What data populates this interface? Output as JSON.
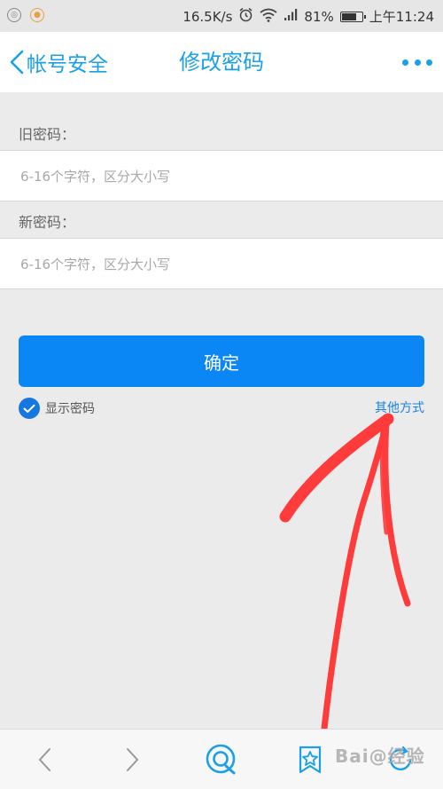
{
  "status_bar": {
    "speed": "16.5K/s",
    "battery": "81%",
    "battery_level": 0.81,
    "time": "上午11:24",
    "icons": [
      "notification-icon",
      "app-icon",
      "alarm-icon",
      "wifi-icon",
      "signal-icon",
      "battery-icon"
    ]
  },
  "header": {
    "back_label": "帐号安全",
    "title": "修改密码",
    "more_icon": "more-dots-icon"
  },
  "form": {
    "old_password": {
      "label": "旧密码：",
      "placeholder": "6-16个字符，区分大小写",
      "value": ""
    },
    "new_password": {
      "label": "新密码：",
      "placeholder": "6-16个字符，区分大小写",
      "value": ""
    },
    "confirm_label": "确定",
    "show_password": {
      "label": "显示密码",
      "checked": true
    },
    "other_methods_label": "其他方式"
  },
  "colors": {
    "accent": "#1aa0e8",
    "button": "#0a86f5",
    "annotation": "#ff3b3b",
    "background": "#ebebeb"
  },
  "bottom_nav": {
    "items": [
      "back-arrow-icon",
      "forward-arrow-icon",
      "browser-home-icon",
      "bookmark-star-icon",
      "refresh-icon"
    ]
  },
  "watermark": "Bai@经验"
}
